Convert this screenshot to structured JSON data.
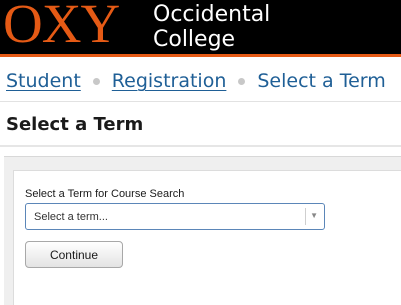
{
  "header": {
    "logo_mark": "OXY",
    "logo_name_line1": "Occidental",
    "logo_name_line2": "College",
    "brand_color": "#e55a15"
  },
  "breadcrumb": {
    "items": [
      {
        "label": "Student"
      },
      {
        "label": "Registration"
      },
      {
        "label": "Select a Term"
      }
    ],
    "link_color": "#1f5f96"
  },
  "page": {
    "title": "Select a Term"
  },
  "form": {
    "term_label": "Select a Term for Course Search",
    "term_select": {
      "placeholder": "Select a term...",
      "arrow_icon": "triangle-down-icon"
    },
    "continue_label": "Continue"
  }
}
